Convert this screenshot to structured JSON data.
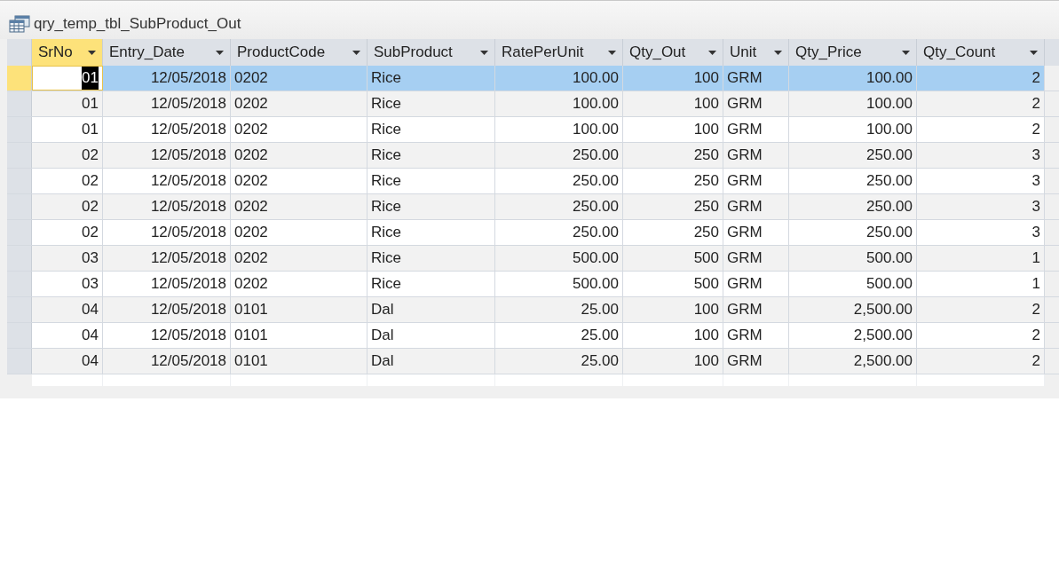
{
  "window": {
    "title": "qry_temp_tbl_SubProduct_Out"
  },
  "table": {
    "columns": [
      {
        "label": "SrNo",
        "kind": "number"
      },
      {
        "label": "Entry_Date",
        "kind": "number"
      },
      {
        "label": "ProductCode",
        "kind": "text"
      },
      {
        "label": "SubProduct",
        "kind": "text"
      },
      {
        "label": "RatePerUnit",
        "kind": "number"
      },
      {
        "label": "Qty_Out",
        "kind": "number"
      },
      {
        "label": "Unit",
        "kind": "text"
      },
      {
        "label": "Qty_Price",
        "kind": "number"
      },
      {
        "label": "Qty_Count",
        "kind": "number"
      }
    ],
    "rows": [
      {
        "selected": true,
        "cells": [
          "01",
          "12/05/2018",
          "0202",
          "Rice",
          "100.00",
          "100",
          "GRM",
          "100.00",
          "2"
        ]
      },
      {
        "selected": false,
        "cells": [
          "01",
          "12/05/2018",
          "0202",
          "Rice",
          "100.00",
          "100",
          "GRM",
          "100.00",
          "2"
        ]
      },
      {
        "selected": false,
        "cells": [
          "01",
          "12/05/2018",
          "0202",
          "Rice",
          "100.00",
          "100",
          "GRM",
          "100.00",
          "2"
        ]
      },
      {
        "selected": false,
        "cells": [
          "02",
          "12/05/2018",
          "0202",
          "Rice",
          "250.00",
          "250",
          "GRM",
          "250.00",
          "3"
        ]
      },
      {
        "selected": false,
        "cells": [
          "02",
          "12/05/2018",
          "0202",
          "Rice",
          "250.00",
          "250",
          "GRM",
          "250.00",
          "3"
        ]
      },
      {
        "selected": false,
        "cells": [
          "02",
          "12/05/2018",
          "0202",
          "Rice",
          "250.00",
          "250",
          "GRM",
          "250.00",
          "3"
        ]
      },
      {
        "selected": false,
        "cells": [
          "02",
          "12/05/2018",
          "0202",
          "Rice",
          "250.00",
          "250",
          "GRM",
          "250.00",
          "3"
        ]
      },
      {
        "selected": false,
        "cells": [
          "03",
          "12/05/2018",
          "0202",
          "Rice",
          "500.00",
          "500",
          "GRM",
          "500.00",
          "1"
        ]
      },
      {
        "selected": false,
        "cells": [
          "03",
          "12/05/2018",
          "0202",
          "Rice",
          "500.00",
          "500",
          "GRM",
          "500.00",
          "1"
        ]
      },
      {
        "selected": false,
        "cells": [
          "04",
          "12/05/2018",
          "0101",
          "Dal",
          "25.00",
          "100",
          "GRM",
          "2,500.00",
          "2"
        ]
      },
      {
        "selected": false,
        "cells": [
          "04",
          "12/05/2018",
          "0101",
          "Dal",
          "25.00",
          "100",
          "GRM",
          "2,500.00",
          "2"
        ]
      },
      {
        "selected": false,
        "cells": [
          "04",
          "12/05/2018",
          "0101",
          "Dal",
          "25.00",
          "100",
          "GRM",
          "2,500.00",
          "2"
        ]
      }
    ]
  }
}
